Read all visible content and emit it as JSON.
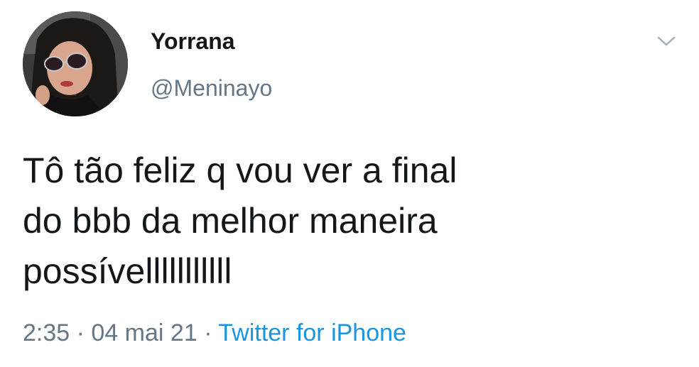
{
  "tweet": {
    "author": {
      "name": "Yorrana",
      "handle": "@Meninayo"
    },
    "text_lines": [
      "Tô tão feliz q vou ver a final",
      "do bbb da melhor maneira",
      "possívelllllllllll"
    ],
    "time": "2:35",
    "separator": "·",
    "date": "04 mai 21",
    "source": "Twitter for iPhone"
  },
  "icons": {
    "menu": "chevron-down-icon"
  },
  "colors": {
    "text": "#14171a",
    "secondary": "#657786",
    "link": "#1b95e0"
  }
}
